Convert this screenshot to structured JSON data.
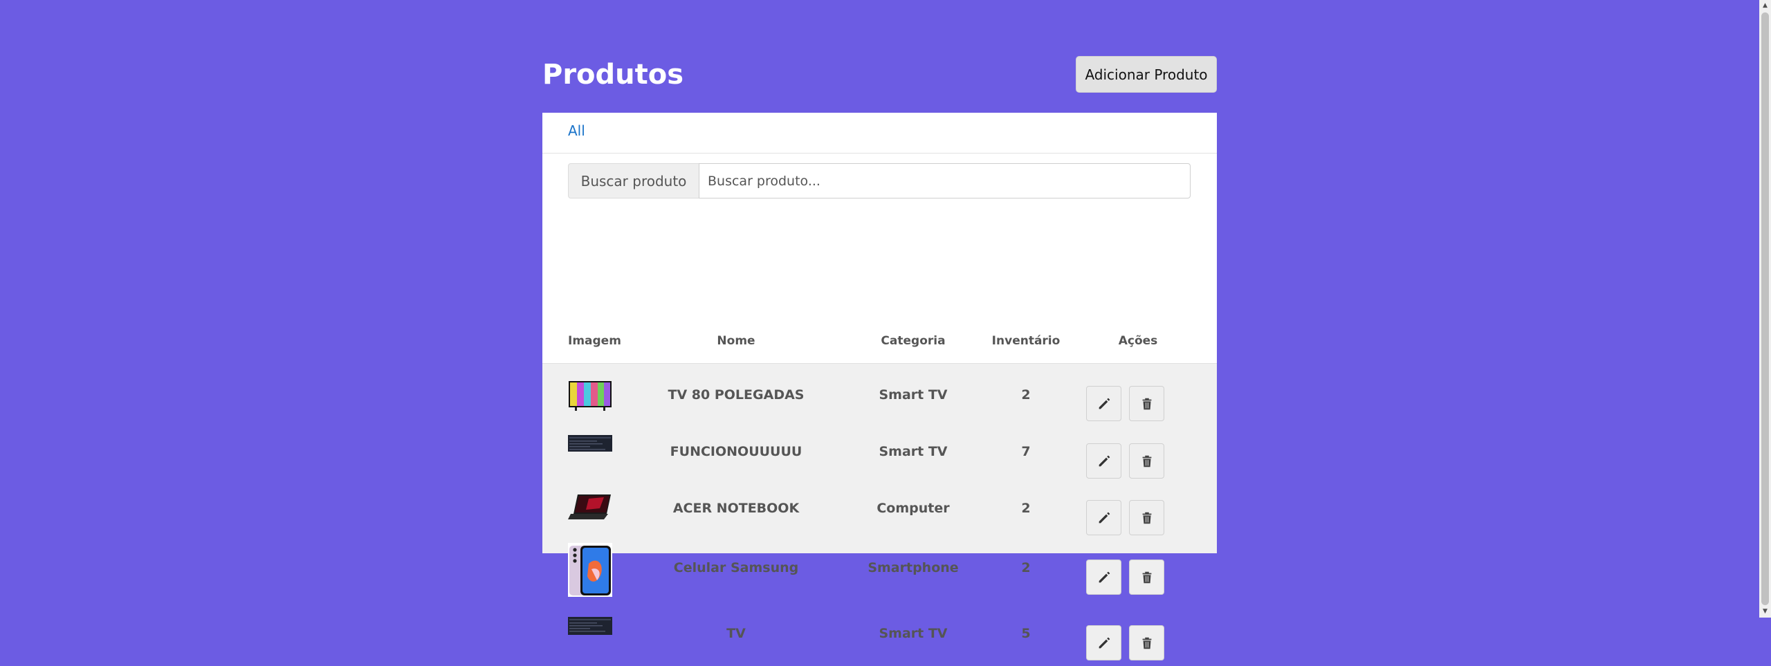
{
  "header": {
    "title": "Produtos",
    "add_button_label": "Adicionar Produto"
  },
  "tabs": [
    {
      "label": "All"
    }
  ],
  "search": {
    "addon_label": "Buscar produto",
    "placeholder": "Buscar produto..."
  },
  "table": {
    "columns": [
      "Imagem",
      "Nome",
      "Categoria",
      "Inventário",
      "Ações"
    ],
    "rows": [
      {
        "name": "TV 80 POLEGADAS",
        "category": "Smart TV",
        "inventory": "2",
        "image": "tv-image"
      },
      {
        "name": "FUNCIONOUUUUU",
        "category": "Smart TV",
        "inventory": "7",
        "image": "screenshot-image"
      },
      {
        "name": "ACER NOTEBOOK",
        "category": "Computer",
        "inventory": "2",
        "image": "laptop-image"
      },
      {
        "name": "Celular Samsung",
        "category": "Smartphone",
        "inventory": "2",
        "image": "phone-image"
      },
      {
        "name": "TV",
        "category": "Smart TV",
        "inventory": "5",
        "image": "screenshot-image"
      }
    ]
  },
  "icons": {
    "edit": "pencil-icon",
    "delete": "trash-icon"
  },
  "colors": {
    "background": "#6c5ce3",
    "link": "#1a73c9",
    "table_body": "#f0f0f0"
  }
}
